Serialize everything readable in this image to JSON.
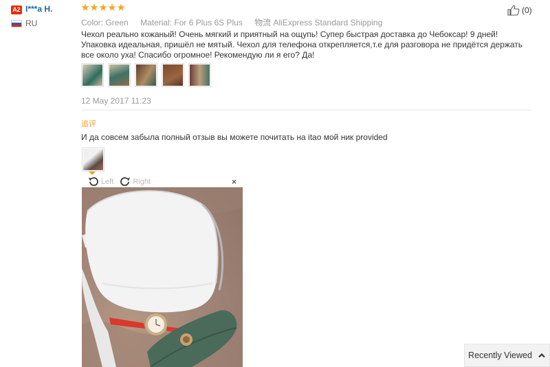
{
  "reviewer": {
    "badge": "A2",
    "name": "I***a H.",
    "country": "RU"
  },
  "review": {
    "rating": 5,
    "meta": {
      "color_label": "Color:",
      "color_value": "Green",
      "material_label": "Material:",
      "material_value": "For 6 Plus 6S Plus",
      "shipping_label": "物流",
      "shipping_value": "AliExpress Standard Shipping"
    },
    "helpful_count": "(0)",
    "text": "Чехол реально кожаный! Очень мягкий и приятный на ощупь! Супер быстрая доставка до Чебоксар! 9 дней! Упаковка идеальная, пришёл не мятый. Чехол для телефона открепляется,т.е для разговора не придётся держать все около уха! Спасибо огромное! Рекомендую ли я его? Да!",
    "photo_count": 5,
    "date": "12 May 2017 11:23"
  },
  "followup": {
    "label": "追评",
    "text": "И да совсем забыла полный отзыв вы можете почитать на itao мой ник provided",
    "photo_count": 1
  },
  "viewer": {
    "rotate_left": "Left",
    "rotate_right": "Right",
    "close": "×"
  },
  "recently_viewed": {
    "label": "Recently Viewed"
  },
  "colors": {
    "accent_orange": "#f0a020",
    "star_color": "#f6a623",
    "name_blue": "#1a66a8",
    "badge_red": "#e62e04"
  }
}
